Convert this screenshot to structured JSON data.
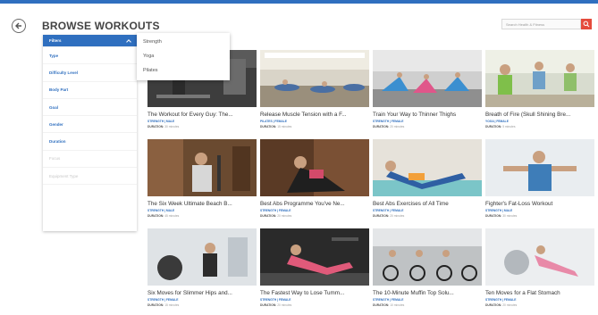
{
  "header": {
    "title": "BROWSE WORKOUTS",
    "search_placeholder": "Search Health & Fitness"
  },
  "filters": {
    "selected": "Filters",
    "items": [
      "Type",
      "Difficulty Level",
      "Body Part",
      "Goal",
      "Gender",
      "Duration"
    ],
    "disabled_items": [
      "Focus",
      "Equipment Type"
    ]
  },
  "dropdown": {
    "options": [
      "Strength",
      "Yoga",
      "Pilates"
    ]
  },
  "colors": {
    "accent": "#2f6fbf",
    "search_button": "#e54b3c"
  },
  "workouts": [
    {
      "title": "The Workout for Every Guy: The...",
      "category": "STRENGTH | MALE",
      "duration_label": "DURATION:",
      "duration": "30 minutes"
    },
    {
      "title": "Release Muscle Tension with a F...",
      "category": "PILATES | FEMALE",
      "duration_label": "DURATION:",
      "duration": "15 minutes"
    },
    {
      "title": "Train Your Way to Thinner Thighs",
      "category": "STRENGTH | FEMALE",
      "duration_label": "DURATION:",
      "duration": "20 minutes"
    },
    {
      "title": "Breath of Fire (Skull Shining Bre...",
      "category": "YOGA | FEMALE",
      "duration_label": "DURATION:",
      "duration": "5 minutes"
    },
    {
      "title": "The Six Week Ultimate Beach B...",
      "category": "STRENGTH | MALE",
      "duration_label": "DURATION:",
      "duration": "45 minutes"
    },
    {
      "title": "Best Abs Programme You've Ne...",
      "category": "STRENGTH | FEMALE",
      "duration_label": "DURATION:",
      "duration": "20 minutes"
    },
    {
      "title": "Best Abs Exercises of All Time",
      "category": "STRENGTH | FEMALE",
      "duration_label": "DURATION:",
      "duration": "20 minutes"
    },
    {
      "title": "Fighter's Fat-Loss Workout",
      "category": "STRENGTH | MALE",
      "duration_label": "DURATION:",
      "duration": "30 minutes"
    },
    {
      "title": "Six Moves for Slimmer Hips and...",
      "category": "STRENGTH | FEMALE",
      "duration_label": "DURATION:",
      "duration": "15 minutes"
    },
    {
      "title": "The Fastest Way to Lose Tumm...",
      "category": "STRENGTH | FEMALE",
      "duration_label": "DURATION:",
      "duration": "20 minutes"
    },
    {
      "title": "The 10-Minute Muffin Top Solu...",
      "category": "STRENGTH | FEMALE",
      "duration_label": "DURATION:",
      "duration": "10 minutes"
    },
    {
      "title": "Ten Moves for a Flat Stomach",
      "category": "STRENGTH | FEMALE",
      "duration_label": "DURATION:",
      "duration": "20 minutes"
    }
  ]
}
